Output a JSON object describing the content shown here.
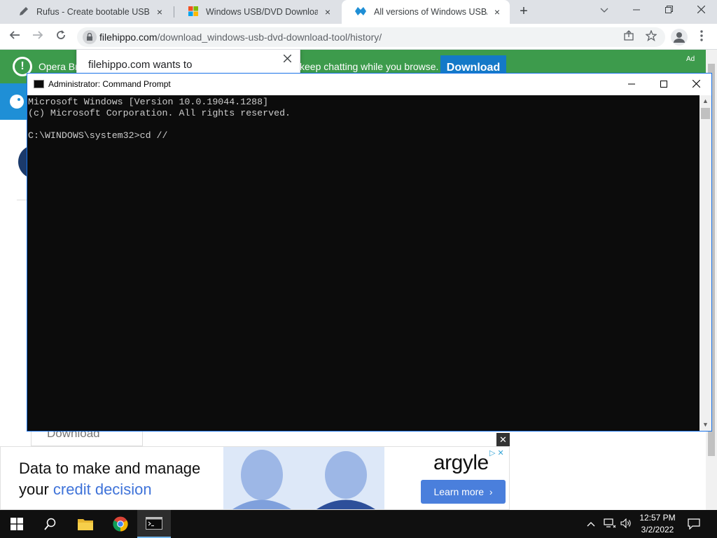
{
  "browser": {
    "tabs": [
      {
        "title": "Rufus - Create bootable USB dri",
        "icon": "pen-icon",
        "active": false
      },
      {
        "title": "Windows USB/DVD Download To",
        "icon": "windows-logo-icon",
        "active": false
      },
      {
        "title": "All versions of Windows USB/DV",
        "icon": "filehippo-icon",
        "active": true
      }
    ],
    "tab_close_glyph": "×",
    "new_tab_glyph": "+",
    "url_host": "filehippo.com",
    "url_path": "/download_windows-usb-dvd-download-tool/history/"
  },
  "opera_ad": {
    "text_left": "Opera Br",
    "text_right": "keep chatting while you browse.",
    "button": "Download",
    "ad_label": "Ad"
  },
  "permission_popup": {
    "text": "filehippo.com wants to"
  },
  "page": {
    "download_label": "Download"
  },
  "banner_ad": {
    "headline_line1": "Data to make and manage",
    "headline_line2_prefix": "your ",
    "headline_line2_highlight": "credit decision",
    "brand": "argyle",
    "cta": "Learn more",
    "cta_arrow": "›",
    "close_glyph": "✕"
  },
  "cmd": {
    "title": "Administrator: Command Prompt",
    "lines": [
      "Microsoft Windows [Version 10.0.19044.1288]",
      "(c) Microsoft Corporation. All rights reserved.",
      "",
      "C:\\WINDOWS\\system32>cd //"
    ]
  },
  "taskbar": {
    "time": "12:57 PM",
    "date": "3/2/2022",
    "pinned": [
      "start-icon",
      "search-icon",
      "file-explorer-icon",
      "chrome-icon",
      "command-prompt-icon"
    ]
  },
  "colors": {
    "opera_green": "#3d9b4c",
    "download_blue": "#1479c8",
    "accent_blue": "#3f73d9",
    "console_bg": "#0c0c0c",
    "console_text": "#cccccc"
  }
}
